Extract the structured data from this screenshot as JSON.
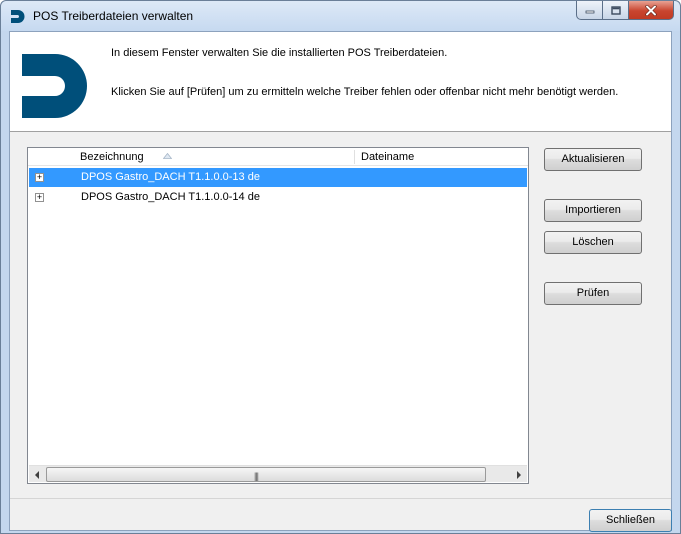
{
  "window": {
    "title": "POS Treiberdateien verwalten",
    "icons": {
      "app": "d-logo-icon",
      "minimize": "minimize-icon",
      "maximize": "maximize-icon",
      "close": "close-icon"
    }
  },
  "header": {
    "intro": "In diesem Fenster verwalten Sie die installierten POS Treiberdateien.",
    "hint": "Klicken Sie auf [Prüfen] um zu ermitteln welche Treiber fehlen oder offenbar nicht mehr benötigt werden.",
    "logo_color": "#004f7a"
  },
  "grid": {
    "columns": [
      "Bezeichnung",
      "Dateiname"
    ],
    "sort_column": "Bezeichnung",
    "sort_direction": "ascending",
    "rows": [
      {
        "label": "DPOS Gastro_DACH T1.1.0.0-13 de",
        "file": "",
        "selected": true
      },
      {
        "label": "DPOS Gastro_DACH T1.1.0.0-14 de",
        "file": "",
        "selected": false
      }
    ],
    "selection_color": "#3399ff"
  },
  "buttons": {
    "refresh": "Aktualisieren",
    "import": "Importieren",
    "delete": "Löschen",
    "check": "Prüfen",
    "close": "Schließen"
  }
}
